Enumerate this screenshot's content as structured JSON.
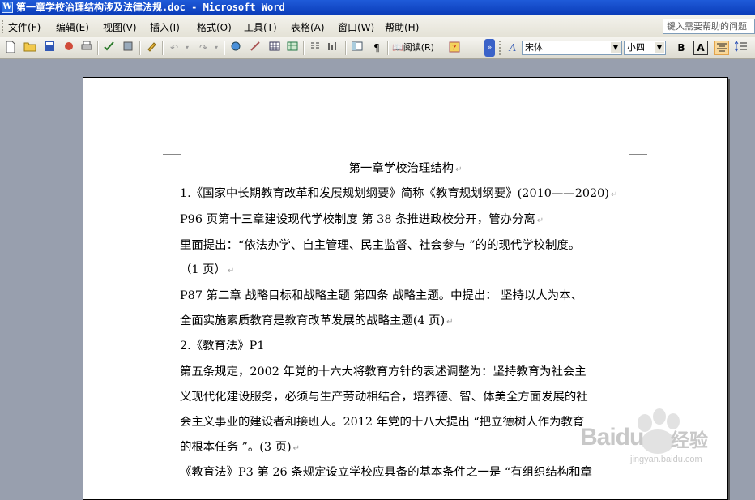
{
  "window": {
    "title": "第一章学校治理结构涉及法律法规.doc - Microsoft Word",
    "app_icon": "W"
  },
  "menu": [
    {
      "label": "文件(F)"
    },
    {
      "label": "编辑(E)"
    },
    {
      "label": "视图(V)"
    },
    {
      "label": "插入(I)"
    },
    {
      "label": "格式(O)"
    },
    {
      "label": "工具(T)"
    },
    {
      "label": "表格(A)"
    },
    {
      "label": "窗口(W)"
    },
    {
      "label": "帮助(H)"
    }
  ],
  "help_box": {
    "placeholder": "键入需要帮助的问题"
  },
  "toolbar": {
    "read_label": "阅读(R)",
    "font_name": "宋体",
    "font_size": "小四",
    "bold_label": "B",
    "char_border_label": "A",
    "style_label": "A"
  },
  "document": {
    "lines": [
      "第一章学校治理结构",
      "1.《国家中长期教育改革和发展规划纲要》简称《教育规划纲要》(2010——2020)",
      "P96 页第十三章建设现代学校制度   第 38 条推进政校分开，管办分离",
      "里面提出：“依法办学、自主管理、民主监督、社会参与 ”的的现代学校制度。",
      "（1 页）",
      "P87 第二章  战略目标和战略主题   第四条  战略主题。中提出：  坚持以人为本、",
      "全面实施素质教育是教育改革发展的战略主题(4 页)",
      "2.《教育法》P1",
      "第五条规定，2002 年党的十六大将教育方针的表述调整为：坚持教育为社会主",
      "义现代化建设服务，必须与生产劳动相结合，培养德、智、体美全方面发展的社",
      "会主义事业的建设者和接班人。2012 年党的十八大提出 “把立德树人作为教育",
      "的根本任务 ”。(3 页)",
      "《教育法》P3 第 26 条规定设立学校应具备的基本条件之一是 “有组织结构和章"
    ],
    "paragraph_mark": "↵"
  },
  "watermark": {
    "brand": "Baidu",
    "sub": "经验",
    "url": "jingyan.baidu.com"
  }
}
